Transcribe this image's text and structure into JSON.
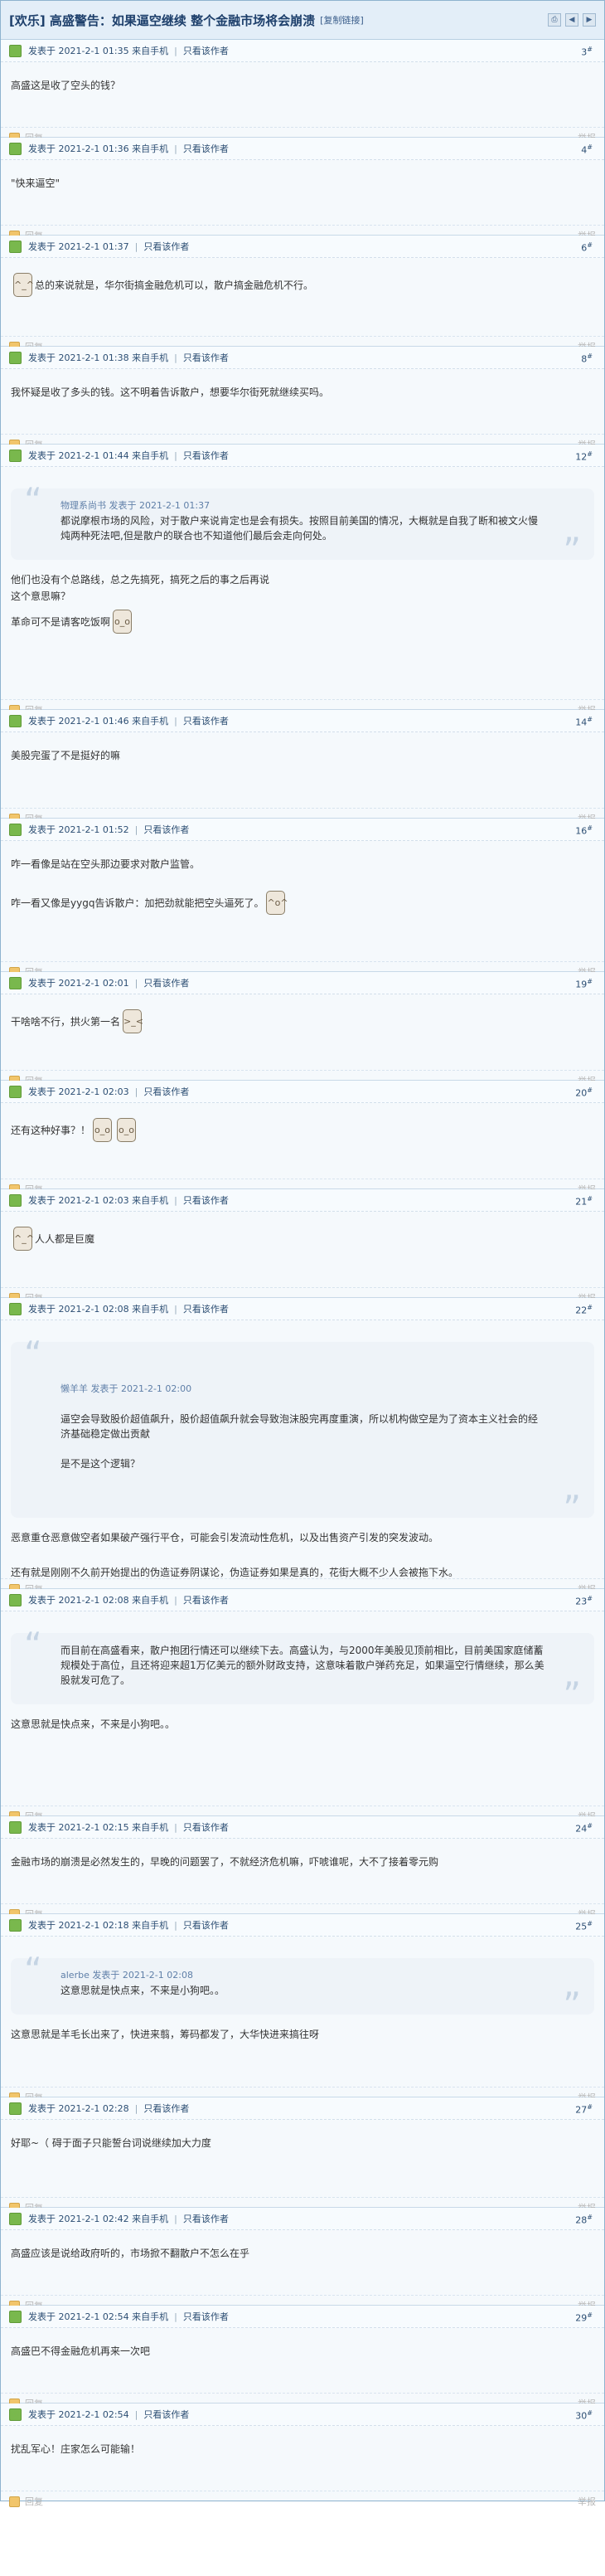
{
  "header": {
    "title": "[欢乐] 高盛警告：如果逼空继续 整个金融市场将会崩溃",
    "copy_link": "[复制链接]",
    "icons": [
      "print-icon",
      "prev-icon",
      "next-icon"
    ]
  },
  "common": {
    "only_author": "只看该作者",
    "reply": "回复",
    "report": "举报"
  },
  "posts": [
    {
      "meta": "发表于 2021-2-1 01:35 来自手机",
      "floor": "3",
      "lines": [
        "高盛这是收了空头的钱？"
      ]
    },
    {
      "meta": "发表于 2021-2-1 01:36 来自手机",
      "floor": "4",
      "lines": [
        "\"快来逼空\""
      ]
    },
    {
      "meta": "发表于 2021-2-1 01:37",
      "floor": "6",
      "lines": [
        "总的来说就是，华尔街搞金融危机可以，散户搞金融危机不行。"
      ]
    },
    {
      "meta": "发表于 2021-2-1 01:38 来自手机",
      "floor": "8",
      "lines": [
        "我怀疑是收了多头的钱。这不明着告诉散户，想要华尔街死就继续买吗。"
      ]
    },
    {
      "meta": "发表于 2021-2-1 01:44 来自手机",
      "floor": "12",
      "quote_src": "物理系尚书 发表于 2021-2-1 01:37",
      "quote": "都说摩根市场的风险，对于散户来说肯定也是会有损失。按照目前美国的情况，大概就是自我了断和被文火慢炖两种死法吧,但是散户的联合也不知道他们最后会走向何处。",
      "lines": [
        "他们也没有个总路线，总之先搞死，搞死之后的事之后再说",
        "这个意思嘛？",
        "革命可不是请客吃饭啊"
      ]
    },
    {
      "meta": "发表于 2021-2-1 01:46 来自手机",
      "floor": "14",
      "lines": [
        "美股完蛋了不是挺好的嘛"
      ]
    },
    {
      "meta": "发表于 2021-2-1 01:52",
      "floor": "16",
      "lines": [
        "咋一看像是站在空头那边要求对散户监管。",
        "咋一看又像是yygq告诉散户：加把劲就能把空头逼死了。"
      ]
    },
    {
      "meta": "发表于 2021-2-1 02:01",
      "floor": "19",
      "lines": [
        "干啥啥不行，拱火第一名"
      ]
    },
    {
      "meta": "发表于 2021-2-1 02:03",
      "floor": "20",
      "lines": [
        "还有这种好事？！"
      ]
    },
    {
      "meta": "发表于 2021-2-1 02:03 来自手机",
      "floor": "21",
      "lines": [
        "人人都是巨魔"
      ]
    },
    {
      "meta": "发表于 2021-2-1 02:08 来自手机",
      "floor": "22",
      "quote_src": "懒羊羊 发表于 2021-2-1 02:00",
      "quote": "逼空会导致股价超值飙升，股价超值飙升就会导致泡沫股完再度重演，所以机构做空是为了资本主义社会的经济基础稳定做出贡献\n\n是不是这个逻辑？",
      "lines": [
        "恶意重仓恶意做空者如果破产强行平仓，可能会引发流动性危机，以及出售资产引发的突发波动。",
        "还有就是刚刚不久前开始提出的伪造证券阴谋论，伪造证券如果是真的，花街大概不少人会被拖下水。"
      ]
    },
    {
      "meta": "发表于 2021-2-1 02:08 来自手机",
      "floor": "23",
      "quote": "而目前在高盛看来，散户抱团行情还可以继续下去。高盛认为，与2000年美股见顶前相比，目前美国家庭储蓄规模处于高位，且还将迎来超1万亿美元的额外财政支持，这意味着散户弹药充足，如果逼空行情继续，那么美股就发可危了。",
      "lines": [
        "这意思就是快点来，不来是小狗吧。。"
      ]
    },
    {
      "meta": "发表于 2021-2-1 02:15 来自手机",
      "floor": "24",
      "lines": [
        "金融市场的崩溃是必然发生的，早晚的问题罢了，不就经济危机嘛，吓唬谁呢，大不了接着零元购"
      ]
    },
    {
      "meta": "发表于 2021-2-1 02:18 来自手机",
      "floor": "25",
      "quote_src": "alerbe 发表于 2021-2-1 02:08",
      "quote": "这意思就是快点来，不来是小狗吧。。",
      "lines": [
        "这意思就是羊毛长出来了，快进来翦，筹码都发了，大华快进来搞往呀"
      ]
    },
    {
      "meta": "发表于 2021-2-1 02:28",
      "floor": "27",
      "lines": [
        "好耶~（ 碍于面子只能誓台词说继续加大力度"
      ]
    },
    {
      "meta": "发表于 2021-2-1 02:42 来自手机",
      "floor": "28",
      "lines": [
        "高盛应该是说给政府听的，市场掀不翻散户不怎么在乎"
      ]
    },
    {
      "meta": "发表于 2021-2-1 02:54 来自手机",
      "floor": "29",
      "lines": [
        "高盛巴不得金融危机再来一次吧"
      ]
    },
    {
      "meta": "发表于 2021-2-1 02:54",
      "floor": "30",
      "lines": [
        "扰乱军心！庄家怎么可能输！"
      ]
    }
  ]
}
